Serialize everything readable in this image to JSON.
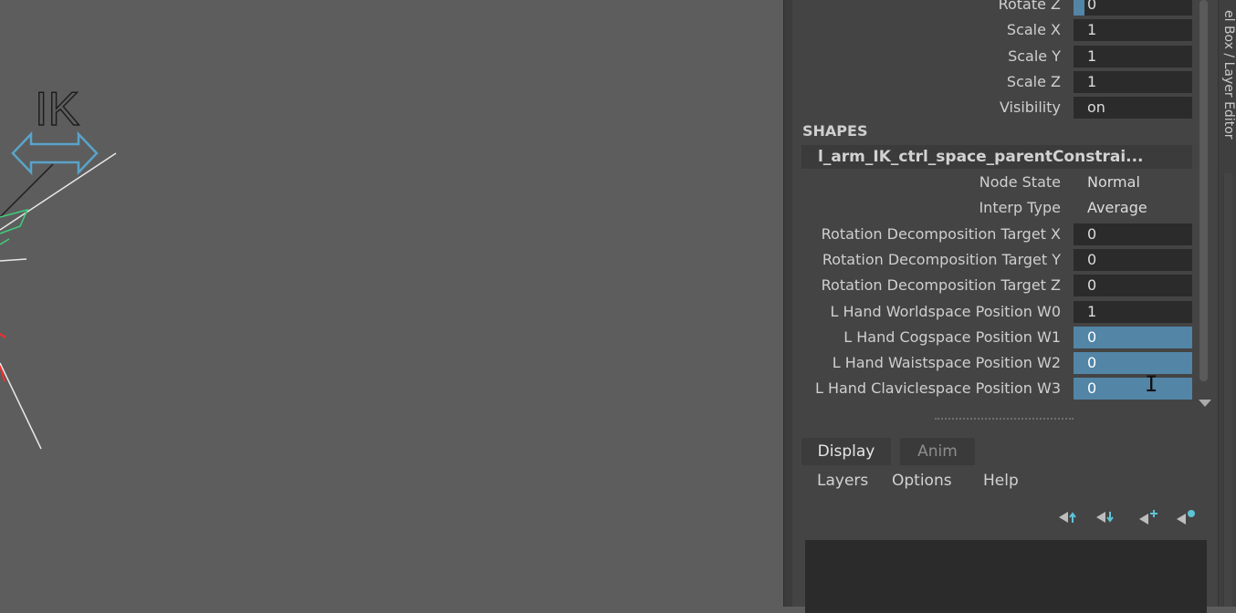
{
  "viewport": {
    "ik_label": "IK"
  },
  "channel_box": {
    "attributes": [
      {
        "label": "Rotate Z",
        "value": "0",
        "style": "key"
      },
      {
        "label": "Scale X",
        "value": "1",
        "style": "normal"
      },
      {
        "label": "Scale Y",
        "value": "1",
        "style": "normal"
      },
      {
        "label": "Scale Z",
        "value": "1",
        "style": "normal"
      },
      {
        "label": "Visibility",
        "value": "on",
        "style": "normal"
      }
    ],
    "shapes_header": "SHAPES",
    "node_name": "l_arm_IK_ctrl_space_parentConstrai...",
    "shape_attributes": [
      {
        "label": "Node State",
        "value": "Normal",
        "style": "plain"
      },
      {
        "label": "Interp Type",
        "value": "Average",
        "style": "plain"
      },
      {
        "label": "Rotation Decomposition Target X",
        "value": "0",
        "style": "normal"
      },
      {
        "label": "Rotation Decomposition Target Y",
        "value": "0",
        "style": "normal"
      },
      {
        "label": "Rotation Decomposition Target Z",
        "value": "0",
        "style": "normal"
      },
      {
        "label": "L Hand Worldspace Position W0",
        "value": "1",
        "style": "normal"
      },
      {
        "label": "L Hand Cogspace Position W1",
        "value": "0",
        "style": "selected"
      },
      {
        "label": "L Hand Waistspace Position W2",
        "value": "0",
        "style": "selected"
      },
      {
        "label": "L Hand Claviclespace Position W3",
        "value": "0",
        "style": "selected"
      }
    ]
  },
  "layer_editor": {
    "tabs": [
      {
        "label": "Display",
        "active": true
      },
      {
        "label": "Anim",
        "active": false
      }
    ],
    "menu": [
      "Layers",
      "Options",
      "Help"
    ],
    "icons": [
      "move-layer-up-icon",
      "move-layer-down-icon",
      "new-empty-layer-icon",
      "new-layer-from-selected-icon"
    ]
  },
  "side_tab_label": "el Box / Layer Editor",
  "colors": {
    "selection": "#5285a6",
    "field": "#2b2b2b",
    "panel": "#444444",
    "viewport": "#5d5d5d"
  }
}
